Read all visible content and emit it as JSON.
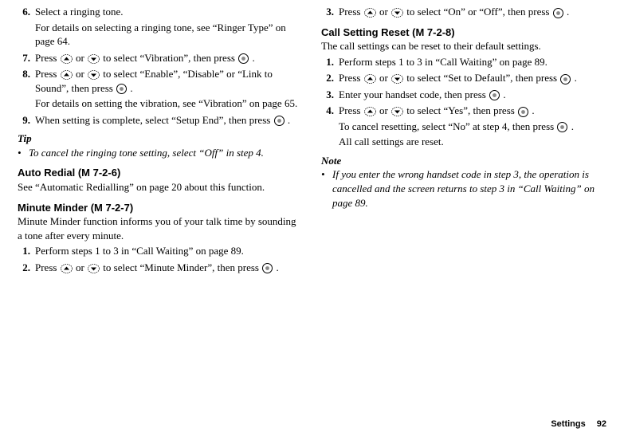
{
  "left": {
    "step6": {
      "num": "6.",
      "line1": "Select a ringing tone.",
      "line2": "For details on selecting a ringing tone, see “Ringer Type” on page 64."
    },
    "step7": {
      "num": "7.",
      "p1": "Press ",
      "p2": " or ",
      "p3": " to select “Vibration”, then press ",
      "p4": " ."
    },
    "step8": {
      "num": "8.",
      "p1": "Press ",
      "p2": " or ",
      "p3": " to select “Enable”, “Disable” or “Link to Sound”, then press ",
      "p4": " .",
      "line2": "For details on setting the vibration, see “Vibration” on page 65."
    },
    "step9": {
      "num": "9.",
      "p1": "When setting is complete, select “Setup End”, then press ",
      "p2": " ."
    },
    "tipLabel": "Tip",
    "tip": "To cancel the ringing tone setting, select “Off” in step 4.",
    "autoRedialHeading": "Auto Redial (M 7-2-6)",
    "autoRedialBody": "See “Automatic Redialling” on page 20 about this function.",
    "minuteHeading": "Minute Minder (M 7-2-7)",
    "minuteBody": "Minute Minder function informs you of your talk time by sounding a tone after every minute.",
    "mm1": {
      "num": "1.",
      "text": "Perform steps 1 to 3 in “Call Waiting” on page 89."
    },
    "mm2": {
      "num": "2.",
      "p1": "Press ",
      "p2": " or ",
      "p3": " to select “Minute Minder”, then press ",
      "p4": " ."
    }
  },
  "right": {
    "mm3": {
      "num": "3.",
      "p1": "Press ",
      "p2": " or ",
      "p3": " to select “On” or “Off”, then press ",
      "p4": " ."
    },
    "resetHeading": "Call Setting Reset (M 7-2-8)",
    "resetBody": "The call settings can be reset to their default settings.",
    "r1": {
      "num": "1.",
      "text": "Perform steps 1 to 3 in “Call Waiting” on page 89."
    },
    "r2": {
      "num": "2.",
      "p1": "Press ",
      "p2": " or ",
      "p3": " to select “Set to Default”, then press ",
      "p4": " ."
    },
    "r3": {
      "num": "3.",
      "p1": "Enter your handset code, then press ",
      "p2": " ."
    },
    "r4": {
      "num": "4.",
      "p1": "Press ",
      "p2": " or ",
      "p3": " to select “Yes”, then press ",
      "p4": " .",
      "line2a": "To cancel resetting, select “No” at step 4, then press ",
      "line2b": " .",
      "line3": "All call settings are reset."
    },
    "noteLabel": "Note",
    "note": "If you enter the wrong handset code in step 3, the operation is cancelled and the screen returns to step 3 in “Call Waiting” on page 89."
  },
  "footer": {
    "label": "Settings",
    "page": "92"
  }
}
